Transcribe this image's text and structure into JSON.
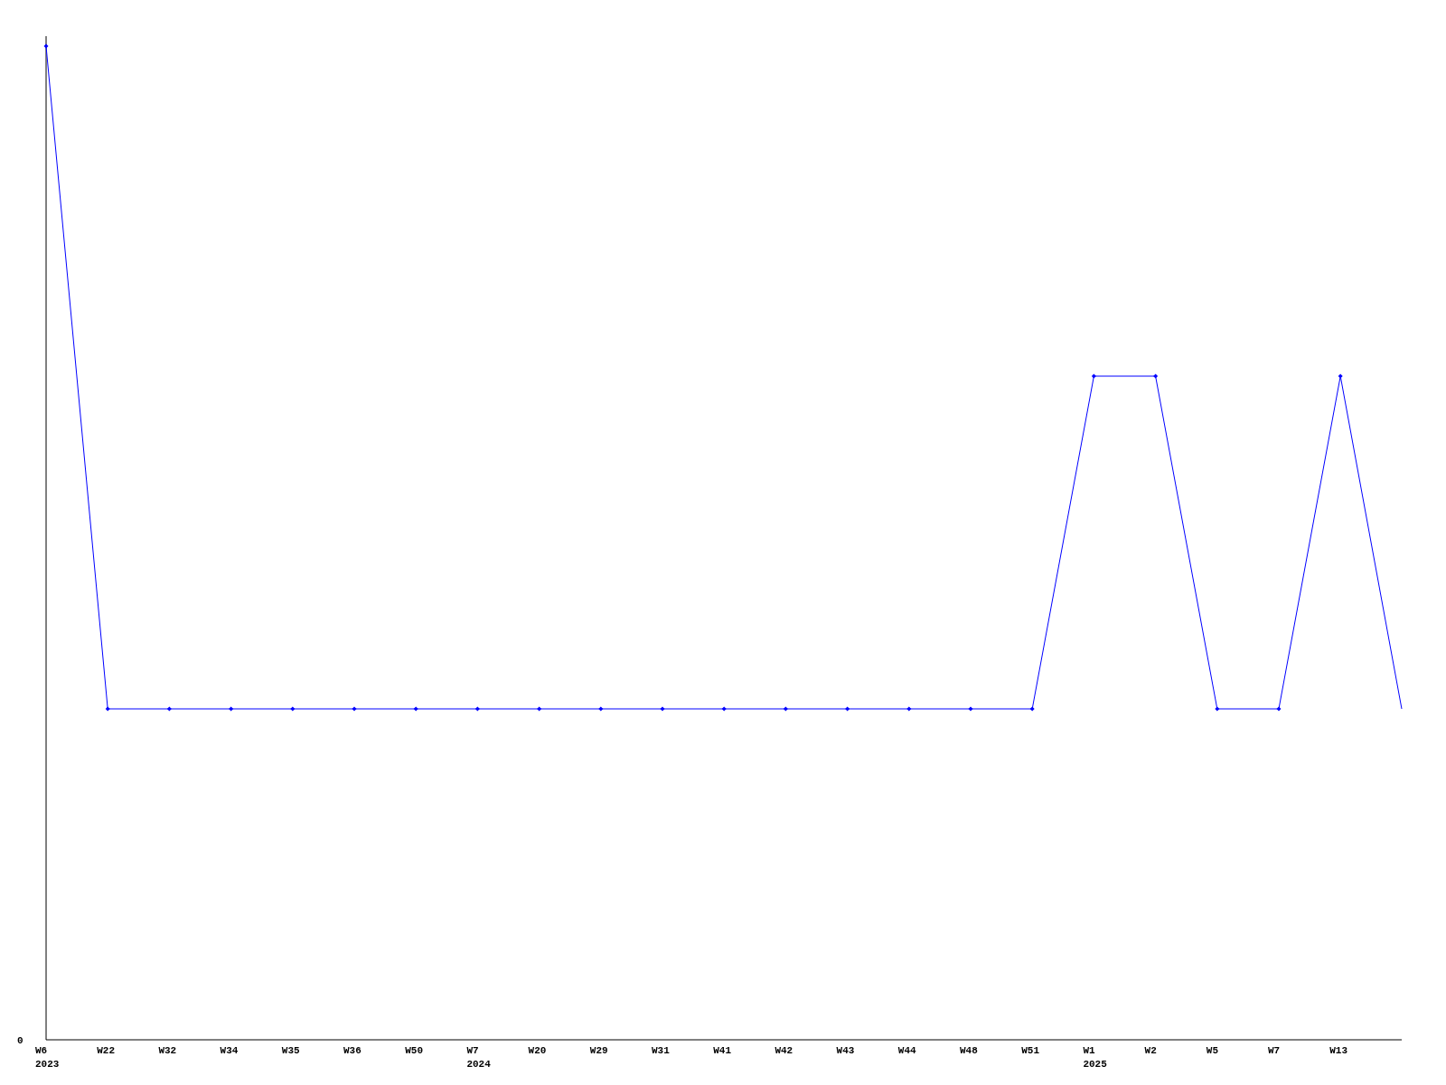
{
  "chart": {
    "y_tick": "0",
    "x_ticks": [
      {
        "week": "W6",
        "year": "2023"
      },
      {
        "week": "W22"
      },
      {
        "week": "W32"
      },
      {
        "week": "W34"
      },
      {
        "week": "W35"
      },
      {
        "week": "W36"
      },
      {
        "week": "W50"
      },
      {
        "week": "W7",
        "year": "2024"
      },
      {
        "week": "W20"
      },
      {
        "week": "W29"
      },
      {
        "week": "W31"
      },
      {
        "week": "W41"
      },
      {
        "week": "W42"
      },
      {
        "week": "W43"
      },
      {
        "week": "W44"
      },
      {
        "week": "W48"
      },
      {
        "week": "W51"
      },
      {
        "week": "W1",
        "year": "2025"
      },
      {
        "week": "W2"
      },
      {
        "week": "W5"
      },
      {
        "week": "W7"
      },
      {
        "week": "W13"
      }
    ]
  }
}
